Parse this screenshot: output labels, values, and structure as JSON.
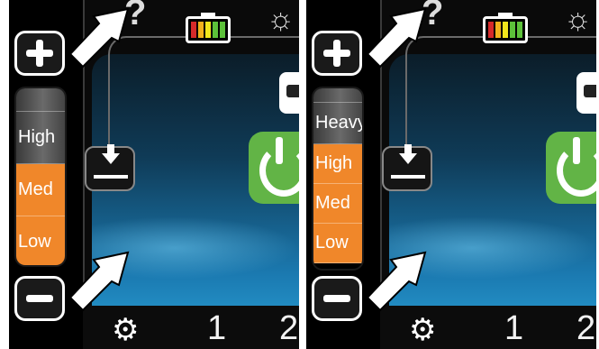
{
  "panels": [
    {
      "id": "left",
      "levels": [
        "High",
        "Med",
        "Low"
      ],
      "bottom_numbers": [
        "1",
        "2"
      ]
    },
    {
      "id": "right",
      "levels": [
        "Heavy Duty",
        "High",
        "Med",
        "Low"
      ],
      "bottom_numbers": [
        "1",
        "2"
      ]
    }
  ],
  "colors": {
    "orange": "#f0872a",
    "green": "#62b446",
    "battery": [
      "#d62a2a",
      "#f2b21c",
      "#f2e61c",
      "#5cc13a",
      "#5cc13a"
    ]
  },
  "icons": [
    "plus-icon",
    "minus-icon",
    "help-icon",
    "battery-icon",
    "robot-icon",
    "download-icon",
    "power-icon",
    "settings-icon",
    "pointer-arrow-icon"
  ]
}
